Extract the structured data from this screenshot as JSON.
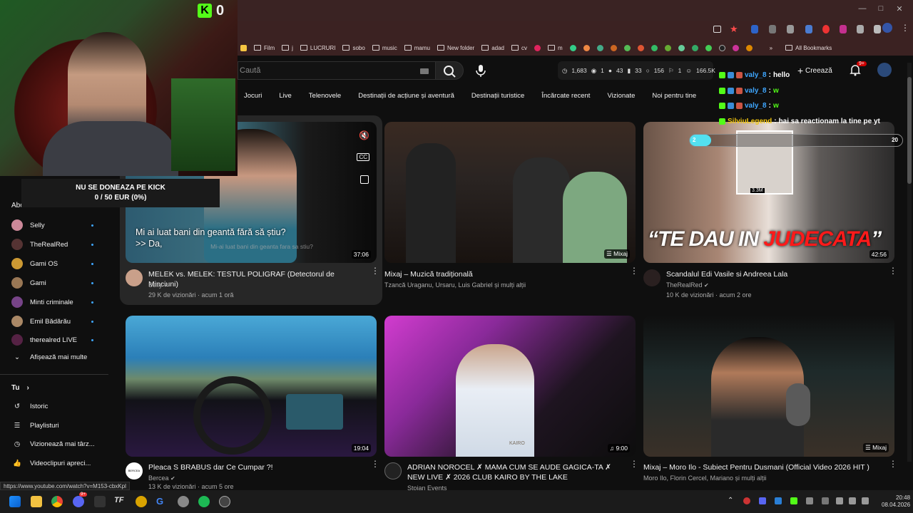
{
  "stream": {
    "kick_count": "0",
    "donation_title": "NU SE DONEAZA PE KICK",
    "donation_progress": "0 / 50 EUR (0%)",
    "progress_fraction": 0,
    "chat": [
      {
        "user": "valy_8",
        "message": "hello"
      },
      {
        "user": "valy_8",
        "message": "w"
      },
      {
        "user": "valy_8",
        "message": "w"
      },
      {
        "user": "SilviuLegend",
        "message": "hai sa reactionam la tine pe yt"
      }
    ],
    "chat_bar_left": "2",
    "chat_bar_right": "20"
  },
  "browser": {
    "bookmarks": [
      "Film",
      "j",
      "LUCRURI",
      "sobo",
      "music",
      "mamu",
      "New folder",
      "adad",
      "cv",
      "m"
    ],
    "all_bookmarks": "All Bookmarks",
    "status_url": "https://www.youtube.com/watch?v=M153-cbxKpl"
  },
  "header": {
    "search_placeholder": "Caută",
    "stats": [
      "1,683",
      "1",
      "43",
      "33",
      "156",
      "1",
      "166.5K"
    ],
    "create_label": "Creează",
    "notif_badge": "9+"
  },
  "chips": [
    "Jocuri",
    "Live",
    "Telenovele",
    "Destinații de acțiune și aventură",
    "Destinații turistice",
    "Încărcate recent",
    "Vizionate",
    "Noi pentru tine"
  ],
  "sidebar": {
    "subs_header": "Abonamente",
    "subs": [
      "Selly",
      "TheRealRed",
      "Gami OS",
      "Gami",
      "Minti criminale",
      "Emil Bădărău",
      "therealred LIVE"
    ],
    "show_more": "Afișează mai multe",
    "you_header": "Tu",
    "you_items": [
      "Istoric",
      "Playlisturi",
      "Vizionează mai târz...",
      "Videoclipuri apreci..."
    ]
  },
  "videos": [
    {
      "title": "MELEK vs. MELEK: TESTUL POLIGRAF (Detectorul de Minciuni)",
      "channel": "Selly",
      "meta": "29 K de vizionări · acum 1 oră",
      "duration": "37:06",
      "caption1": "Mi ai luat bani din geantă fără să știu?",
      "caption2": ">> Da,",
      "caption_faded": "Mi-ai luat bani din geanta fara sa stiu?"
    },
    {
      "title": "Mixaj – Muzică tradițională",
      "channel": "Tzancă Uraganu, Ursaru, Luis Gabriel și mulți alții",
      "meta": "",
      "duration": "Mixaj"
    },
    {
      "title": "Scandalul Edi Vasile si Andreea Lala",
      "channel": "TheRealRed",
      "meta": "10 K de vizionări · acum 2 ore",
      "duration": "42:56",
      "overlay_white": "“TE DAU IN",
      "overlay_red": "JUDECATA",
      "overlay_end": "”",
      "overlay_views": "3.3M"
    },
    {
      "title": "Pleaca S BRABUS dar Ce Cumpar ?!",
      "channel": "Bercea",
      "meta": "13 K de vizionări · acum 5 ore",
      "duration": "19:04",
      "avatar_text": "BERCEA"
    },
    {
      "title": "ADRIAN NOROCEL ✗ MAMA CUM SE AUDE GAGICA-TA ✗ NEW LIVE ✗ 2026 CLUB KAIRO BY THE LAKE",
      "channel": "Stoian Events",
      "meta": "",
      "duration": "9:00",
      "thumb_text": "KAIRO"
    },
    {
      "title": "Mixaj – Moro Ilo - Subiect Pentru Dusmani (Official Video 2026 HIT )",
      "channel": "Moro Ilo, Florin Cercel, Mariano și mulți alții",
      "meta": "",
      "duration": "Mixaj"
    }
  ],
  "taskbar": {
    "time": "20:48",
    "date": "08.04.2026",
    "discord_badge": "9+"
  },
  "colors": {
    "bg": "#0f0f0f",
    "chrome_frame": "#3b2222",
    "accent_blue": "#3ea6ff",
    "kick_green": "#53fc18",
    "red": "#ff0000"
  }
}
